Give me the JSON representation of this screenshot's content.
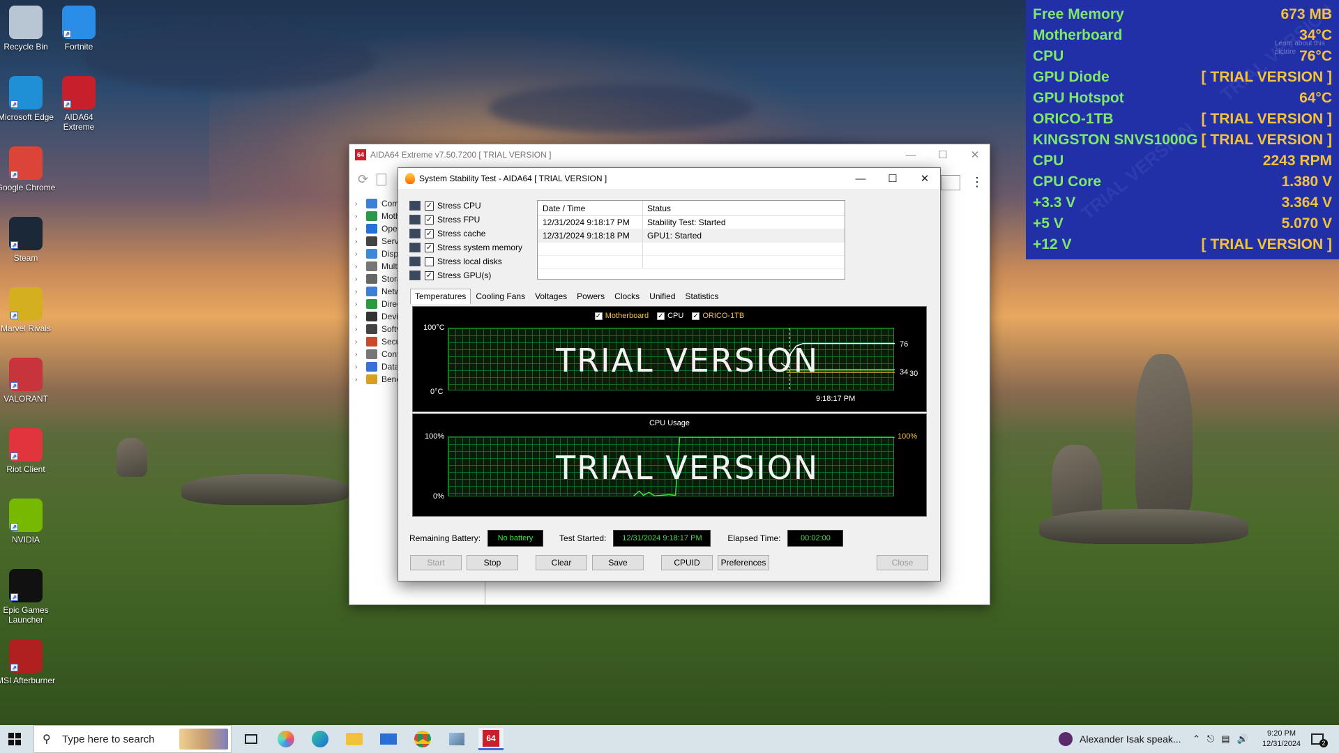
{
  "desktop_icons": [
    {
      "label": "Recycle Bin",
      "icon": "recycle-bin-icon",
      "color": "#b8c6d4"
    },
    {
      "label": "Microsoft Edge",
      "icon": "edge-icon",
      "color": "#1f8fd6"
    },
    {
      "label": "Google Chrome",
      "icon": "chrome-icon",
      "color": "#dc4437"
    },
    {
      "label": "Steam",
      "icon": "steam-icon",
      "color": "#1b2838"
    },
    {
      "label": "Marvel Rivals",
      "icon": "marvel-rivals-icon",
      "color": "#d4b020"
    },
    {
      "label": "VALORANT",
      "icon": "valorant-icon",
      "color": "#c8343c"
    },
    {
      "label": "Riot Client",
      "icon": "riot-client-icon",
      "color": "#e0353c"
    },
    {
      "label": "NVIDIA",
      "icon": "nvidia-icon",
      "color": "#76b900"
    },
    {
      "label": "Epic Games Launcher",
      "icon": "epic-games-icon",
      "color": "#111111"
    },
    {
      "label": "MSI Afterburner",
      "icon": "msi-afterburner-icon",
      "color": "#b02020"
    },
    {
      "label": "Fortnite",
      "icon": "fortnite-icon",
      "color": "#2a8ee8"
    },
    {
      "label": "AIDA64 Extreme",
      "icon": "aida64-icon",
      "color": "#c8202a"
    }
  ],
  "osd": {
    "rows": [
      {
        "label": "Free Memory",
        "value": "673 MB"
      },
      {
        "label": "Motherboard",
        "value": "34°C"
      },
      {
        "label": "CPU",
        "value": "76°C"
      },
      {
        "label": "GPU Diode",
        "value": "[ TRIAL VERSION ]"
      },
      {
        "label": "GPU Hotspot",
        "value": "64°C"
      },
      {
        "label": "ORICO-1TB",
        "value": "[ TRIAL VERSION ]"
      },
      {
        "label": "KINGSTON SNVS1000G",
        "value": "[ TRIAL VERSION ]"
      },
      {
        "label": "CPU",
        "value": "2243 RPM"
      },
      {
        "label": "CPU Core",
        "value": "1.380 V"
      },
      {
        "label": "+3.3 V",
        "value": "3.364 V"
      },
      {
        "label": "+5 V",
        "value": "5.070 V"
      },
      {
        "label": "+12 V",
        "value": "[ TRIAL VERSION ]"
      }
    ],
    "watermark": "TRIAL VERSION",
    "learn_about": "Learn about this picture"
  },
  "main_window": {
    "title": "AIDA64 Extreme v7.50.7200  [ TRIAL VERSION ]",
    "tree": [
      "Comp",
      "Moth",
      "Oper",
      "Serve",
      "Displ",
      "Multi",
      "Stora",
      "Netw",
      "Direc",
      "Devic",
      "Softv",
      "Secur",
      "Conf",
      "Datab",
      "Bench"
    ]
  },
  "dialog": {
    "title": "System Stability Test - AIDA64  [ TRIAL VERSION ]",
    "stress_options": [
      {
        "label": "Stress CPU",
        "checked": true
      },
      {
        "label": "Stress FPU",
        "checked": true
      },
      {
        "label": "Stress cache",
        "checked": true
      },
      {
        "label": "Stress system memory",
        "checked": true
      },
      {
        "label": "Stress local disks",
        "checked": false
      },
      {
        "label": "Stress GPU(s)",
        "checked": true
      }
    ],
    "log": {
      "headers": [
        "Date / Time",
        "Status"
      ],
      "rows": [
        [
          "12/31/2024 9:18:17 PM",
          "Stability Test: Started"
        ],
        [
          "12/31/2024 9:18:18 PM",
          "GPU1: Started"
        ]
      ]
    },
    "tabs": [
      "Temperatures",
      "Cooling Fans",
      "Voltages",
      "Powers",
      "Clocks",
      "Unified",
      "Statistics"
    ],
    "temp_graph": {
      "legend": [
        {
          "label": "Motherboard",
          "color": "#f3c23c"
        },
        {
          "label": "CPU",
          "color": "#ffffff"
        },
        {
          "label": "ORICO-1TB",
          "color": "#f3c23c"
        }
      ],
      "y_top": "100°C",
      "y_bottom": "0°C",
      "time_label": "9:18:17 PM",
      "right_value_1": "76",
      "right_value_2": "34",
      "right_value_3": "30",
      "watermark": "TRIAL VERSION",
      "ylim": [
        0,
        100
      ],
      "cpu_temp": 76,
      "motherboard_temp": 34,
      "orico_temp": 30
    },
    "usage_graph": {
      "title": "CPU Usage",
      "y_top": "100%",
      "y_bottom": "0%",
      "right_value": "100%",
      "watermark": "TRIAL VERSION",
      "ylim": [
        0,
        100
      ],
      "current": 100
    },
    "status": {
      "battery_label": "Remaining Battery:",
      "battery_value": "No battery",
      "started_label": "Test Started:",
      "started_value": "12/31/2024 9:18:17 PM",
      "elapsed_label": "Elapsed Time:",
      "elapsed_value": "00:02:00"
    },
    "buttons": {
      "start": "Start",
      "stop": "Stop",
      "clear": "Clear",
      "save": "Save",
      "cpuid": "CPUID",
      "preferences": "Preferences",
      "close": "Close"
    }
  },
  "taskbar": {
    "search_placeholder": "Type here to search",
    "notification": "Alexander Isak speak...",
    "time": "9:20 PM",
    "date": "12/31/2024",
    "badge": "2"
  },
  "colors": {
    "osd_bg": "#2230a8",
    "osd_label": "#7ee86a",
    "osd_value": "#f3c23c",
    "status_text": "#43e04a"
  }
}
